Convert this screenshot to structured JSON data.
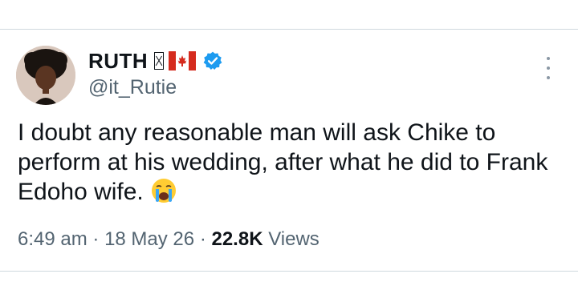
{
  "tweet": {
    "author": {
      "display_name": "RUTH",
      "handle": "@it_Rutie"
    },
    "text_main": "I doubt any reasonable man will ask Chike to perform at his wedding, after what he did to Frank Edoho wife.",
    "emoji": "crying-face-emoji",
    "meta": {
      "time": "6:49 am",
      "separator": "·",
      "date": "18 May 26",
      "separator2": "·",
      "views_count": "22.8K",
      "views_label": "Views"
    }
  },
  "icons": {
    "flag": "canada-flag-icon",
    "verified": "verified-badge-icon",
    "more": "more-options-icon"
  },
  "colors": {
    "verified_blue": "#1d9bf0",
    "secondary_text": "#536471",
    "flag_red": "#d52b1e"
  }
}
